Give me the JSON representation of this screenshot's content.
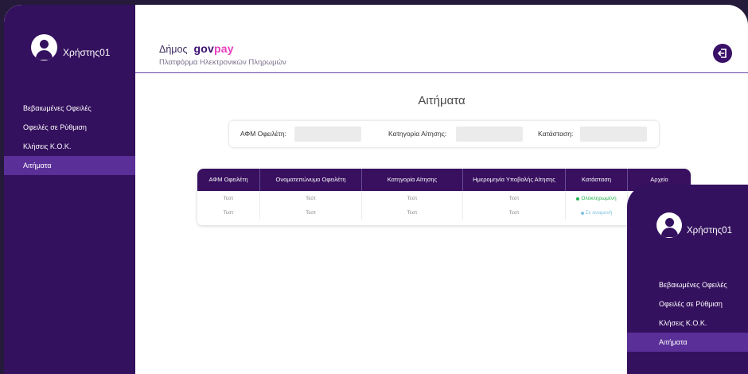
{
  "user": {
    "name": "Χρήστης01"
  },
  "sidebar": {
    "items": [
      {
        "label": "Βεβαιωμένες Οφειλές"
      },
      {
        "label": "Οφειλές σε Ρύθμιση"
      },
      {
        "label": "Κλήσεις Κ.Ο.Κ."
      },
      {
        "label": "Αιτήματα",
        "active": true
      }
    ]
  },
  "header": {
    "demos": "Δήμος",
    "logo_gov": "gov",
    "logo_pay": "pay",
    "subtitle": "Πλατφόρμα Ηλεκτρονικών Πληρωμών",
    "logout_icon": "logout-icon"
  },
  "main": {
    "title": "Αιτήματα"
  },
  "filters": {
    "afm_label": "ΑΦΜ Οφειλέτη:",
    "afm_value": "",
    "category_label": "Κατηγορία Αίτησης:",
    "category_value": "",
    "status_label": "Κατάσταση:",
    "status_value": ""
  },
  "table": {
    "headers": [
      "ΑΦΜ Οφειλέτη",
      "Ονοματεπώνυμο Οφειλέτη",
      "Κατηγορία Αίτησης",
      "Ημερομηνία Υποβολής Αίτησης",
      "Κατάσταση",
      "Αρχείο"
    ],
    "rows": [
      {
        "afm": "Τεστ",
        "name": "Τεστ",
        "category": "Τεστ",
        "date": "Τεστ",
        "status": "Ολοκληρωμένη",
        "status_color": "#22b14c"
      },
      {
        "afm": "Τεστ",
        "name": "Τεστ",
        "category": "Τεστ",
        "date": "Τεστ",
        "status": "Σε αναμονή",
        "status_color": "#7fc4de"
      }
    ]
  },
  "colors": {
    "sidebar": "#34115e",
    "active": "#5a2f98",
    "accent": "#e83fbd",
    "header_line": "#6a48a6"
  }
}
